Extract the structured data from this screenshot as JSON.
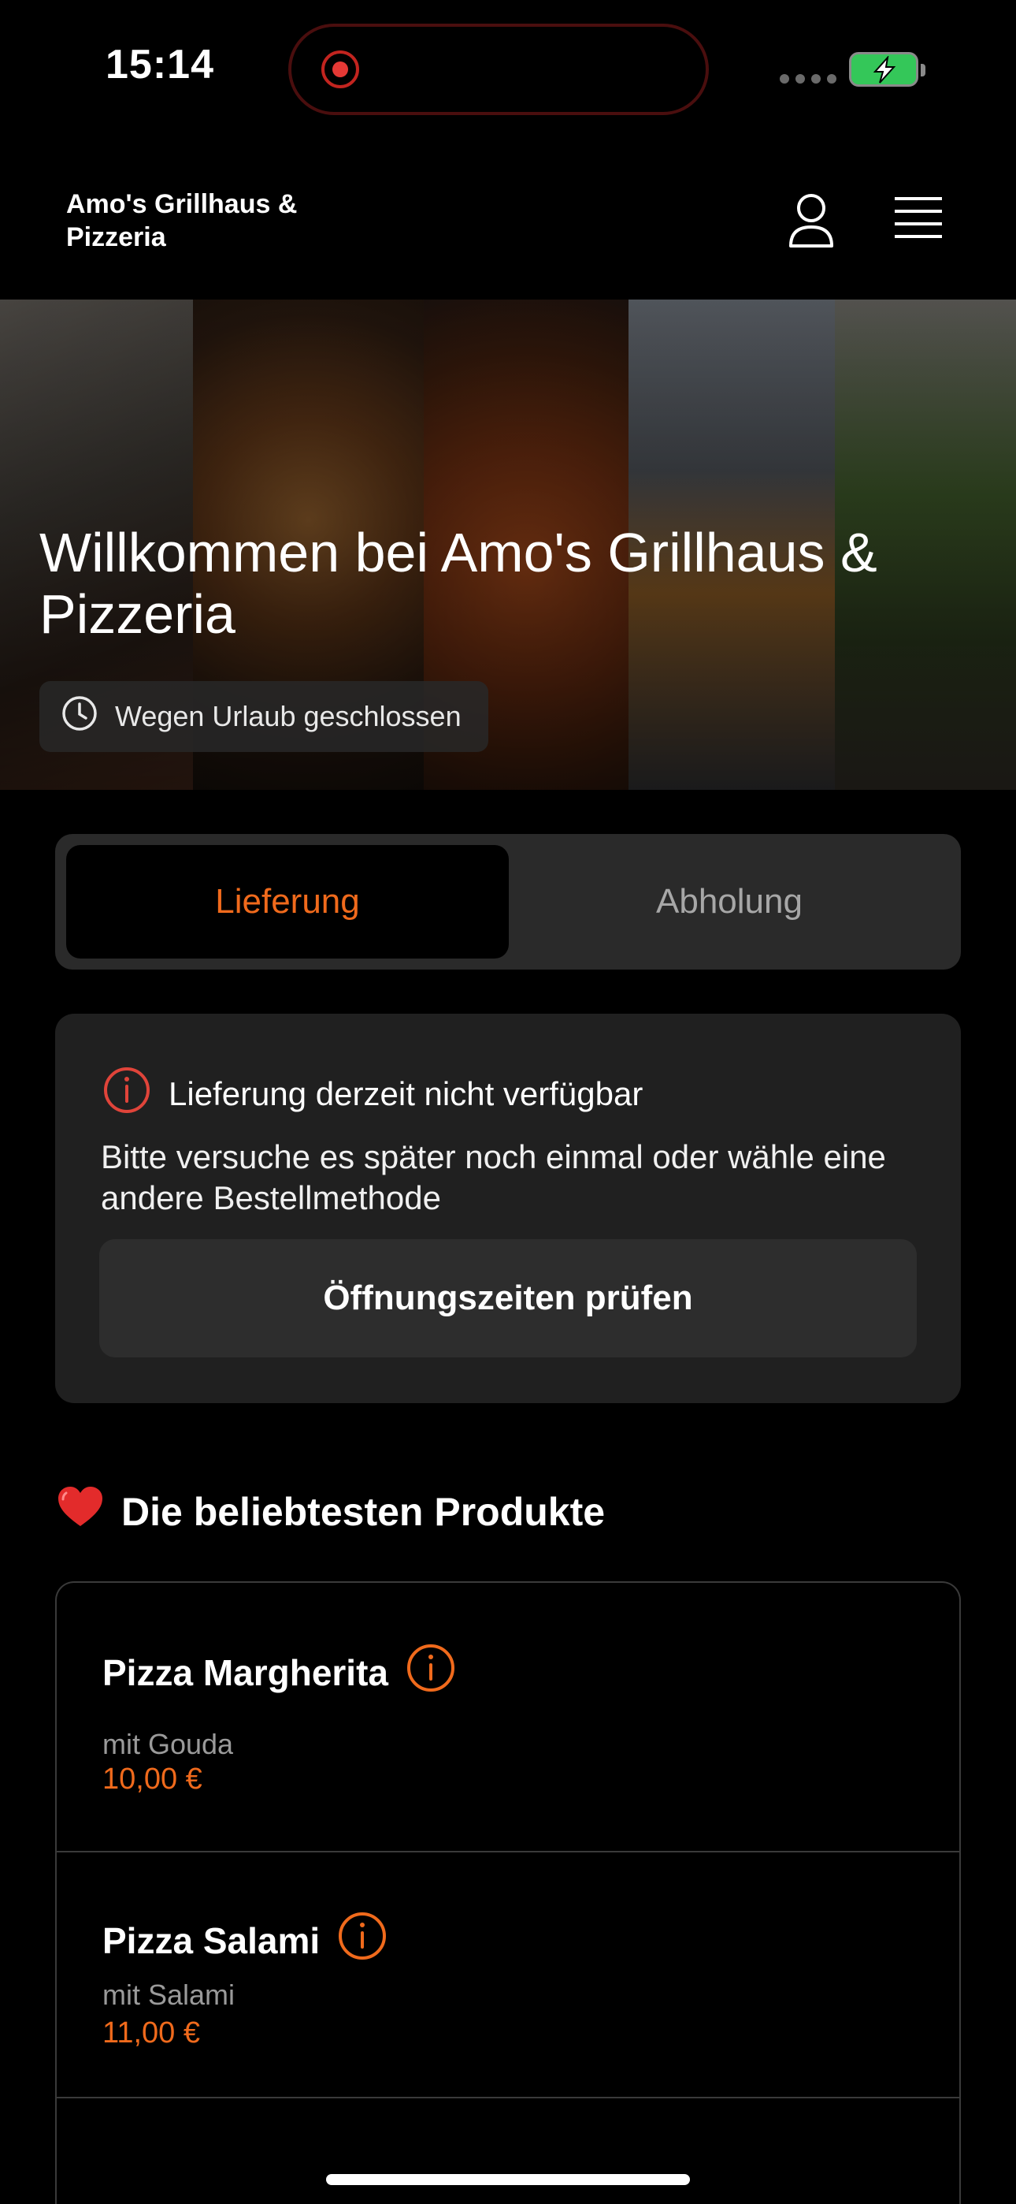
{
  "status_bar": {
    "time": "15:14"
  },
  "header": {
    "brand": "Amo's Grillhaus & Pizzeria",
    "profile_icon": "person-icon",
    "menu_icon": "hamburger-menu-icon"
  },
  "hero": {
    "title": "Willkommen bei Amo's Grillhaus & Pizzeria",
    "status": "Wegen Urlaub geschlossen"
  },
  "order_mode": {
    "delivery_label": "Lieferung",
    "pickup_label": "Abholung",
    "selected": "Lieferung"
  },
  "notice": {
    "title": "Lieferung derzeit nicht verfügbar",
    "text": "Bitte versuche es später noch einmal oder wähle eine andere Bestellmethode",
    "button_label": "Öffnungszeiten prüfen"
  },
  "popular": {
    "heading": "Die beliebtesten Produkte",
    "products": [
      {
        "name": "Pizza Margherita",
        "description": "mit Gouda",
        "price": "10,00 €"
      },
      {
        "name": "Pizza Salami",
        "description": "mit Salami",
        "price": "11,00 €"
      }
    ]
  },
  "colors": {
    "accent": "#f06a1c",
    "background": "#000000",
    "card": "#202020",
    "battery": "#34c759",
    "alert": "#e0443a"
  }
}
